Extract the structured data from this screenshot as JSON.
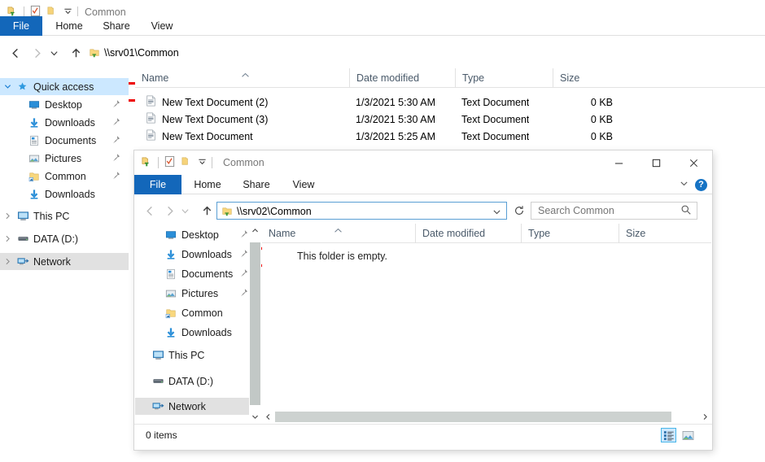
{
  "window1": {
    "title": "Common",
    "quick_access_icons": [
      "folder-pin-icon",
      "properties-icon",
      "new-folder-icon",
      "customize-chevron-icon"
    ],
    "ribbon_tabs": [
      {
        "label": "File",
        "active": true
      },
      {
        "label": "Home",
        "active": false
      },
      {
        "label": "Share",
        "active": false
      },
      {
        "label": "View",
        "active": false
      }
    ],
    "address": {
      "path": "\\\\srv01\\Common",
      "highlighted": true
    },
    "nav_buttons": [
      "back-icon",
      "forward-icon",
      "recent-locations-icon",
      "up-icon"
    ],
    "sidebar": [
      {
        "label": "Quick access",
        "icon": "star-icon",
        "chevron": "down",
        "indent": 0,
        "selected": true,
        "pinned": false
      },
      {
        "label": "Desktop",
        "icon": "desktop-icon",
        "chevron": "",
        "indent": 1,
        "selected": false,
        "pinned": true
      },
      {
        "label": "Downloads",
        "icon": "download-icon",
        "chevron": "",
        "indent": 1,
        "selected": false,
        "pinned": true
      },
      {
        "label": "Documents",
        "icon": "documents-icon",
        "chevron": "",
        "indent": 1,
        "selected": false,
        "pinned": true
      },
      {
        "label": "Pictures",
        "icon": "pictures-icon",
        "chevron": "",
        "indent": 1,
        "selected": false,
        "pinned": true
      },
      {
        "label": "Common",
        "icon": "shared-folder-icon",
        "chevron": "",
        "indent": 1,
        "selected": false,
        "pinned": true
      },
      {
        "label": "Downloads",
        "icon": "download-icon",
        "chevron": "",
        "indent": 1,
        "selected": false,
        "pinned": false
      },
      {
        "label": "This PC",
        "icon": "this-pc-icon",
        "chevron": "right",
        "indent": 0,
        "selected": false,
        "pinned": false
      },
      {
        "label": "DATA (D:)",
        "icon": "drive-icon",
        "chevron": "right",
        "indent": 0,
        "selected": false,
        "pinned": false
      },
      {
        "label": "Network",
        "icon": "network-icon",
        "chevron": "right",
        "indent": 0,
        "selected": false,
        "pinned": false,
        "selectedGray": true
      }
    ],
    "columns": [
      {
        "label": "Name",
        "sorted": true
      },
      {
        "label": "Date modified",
        "sorted": false
      },
      {
        "label": "Type",
        "sorted": false
      },
      {
        "label": "Size",
        "sorted": false
      }
    ],
    "files": [
      {
        "name": "New Text Document (2)",
        "date": "1/3/2021 5:30 AM",
        "type": "Text Document",
        "size": "0 KB",
        "icon": "text-file-icon"
      },
      {
        "name": "New Text Document (3)",
        "date": "1/3/2021 5:30 AM",
        "type": "Text Document",
        "size": "0 KB",
        "icon": "text-file-icon"
      },
      {
        "name": "New Text Document",
        "date": "1/3/2021 5:25 AM",
        "type": "Text Document",
        "size": "0 KB",
        "icon": "text-file-icon"
      }
    ]
  },
  "window2": {
    "title": "Common",
    "quick_access_icons": [
      "folder-pin-icon",
      "properties-icon",
      "new-folder-icon",
      "customize-chevron-icon"
    ],
    "window_controls": [
      "minimize-icon",
      "maximize-icon",
      "close-icon"
    ],
    "ribbon_tabs": [
      {
        "label": "File",
        "active": true
      },
      {
        "label": "Home",
        "active": false
      },
      {
        "label": "Share",
        "active": false
      },
      {
        "label": "View",
        "active": false
      }
    ],
    "ribbon_right": [
      "ribbon-collapse-chevron-icon",
      "help-icon"
    ],
    "help_glyph": "?",
    "address": {
      "path": "\\\\srv02\\Common",
      "highlighted": true
    },
    "nav_buttons": [
      "back-icon",
      "forward-icon",
      "recent-locations-icon",
      "up-icon"
    ],
    "search": {
      "placeholder": "Search Common",
      "value": ""
    },
    "sidebar": [
      {
        "label": "Desktop",
        "icon": "desktop-icon",
        "chevron": "",
        "indent": 1,
        "pinned": true
      },
      {
        "label": "Downloads",
        "icon": "download-icon",
        "chevron": "",
        "indent": 1,
        "pinned": true
      },
      {
        "label": "Documents",
        "icon": "documents-icon",
        "chevron": "",
        "indent": 1,
        "pinned": true
      },
      {
        "label": "Pictures",
        "icon": "pictures-icon",
        "chevron": "",
        "indent": 1,
        "pinned": true
      },
      {
        "label": "Common",
        "icon": "shared-folder-icon",
        "chevron": "",
        "indent": 1,
        "pinned": false
      },
      {
        "label": "Downloads",
        "icon": "download-icon",
        "chevron": "",
        "indent": 1,
        "pinned": false
      },
      {
        "label": "This PC",
        "icon": "this-pc-icon",
        "chevron": "",
        "indent": 0,
        "pinned": false
      },
      {
        "label": "DATA (D:)",
        "icon": "drive-icon",
        "chevron": "",
        "indent": 0,
        "pinned": false
      },
      {
        "label": "Network",
        "icon": "network-icon",
        "chevron": "",
        "indent": 0,
        "pinned": false,
        "selectedGray": true
      }
    ],
    "columns": [
      {
        "label": "Name",
        "sorted": true
      },
      {
        "label": "Date modified",
        "sorted": false
      },
      {
        "label": "Type",
        "sorted": false
      },
      {
        "label": "Size",
        "sorted": false
      }
    ],
    "empty_message": "This folder is empty.",
    "status": {
      "items_text": "0 items"
    },
    "view_buttons": [
      {
        "name": "details-view-button",
        "active": true
      },
      {
        "name": "large-icons-view-button",
        "active": false
      }
    ]
  },
  "colors": {
    "accent": "#1367ba",
    "highlight_red": "#ee0000",
    "selection_blue": "#cce8ff",
    "folder_yellow": "#ffd95a"
  }
}
